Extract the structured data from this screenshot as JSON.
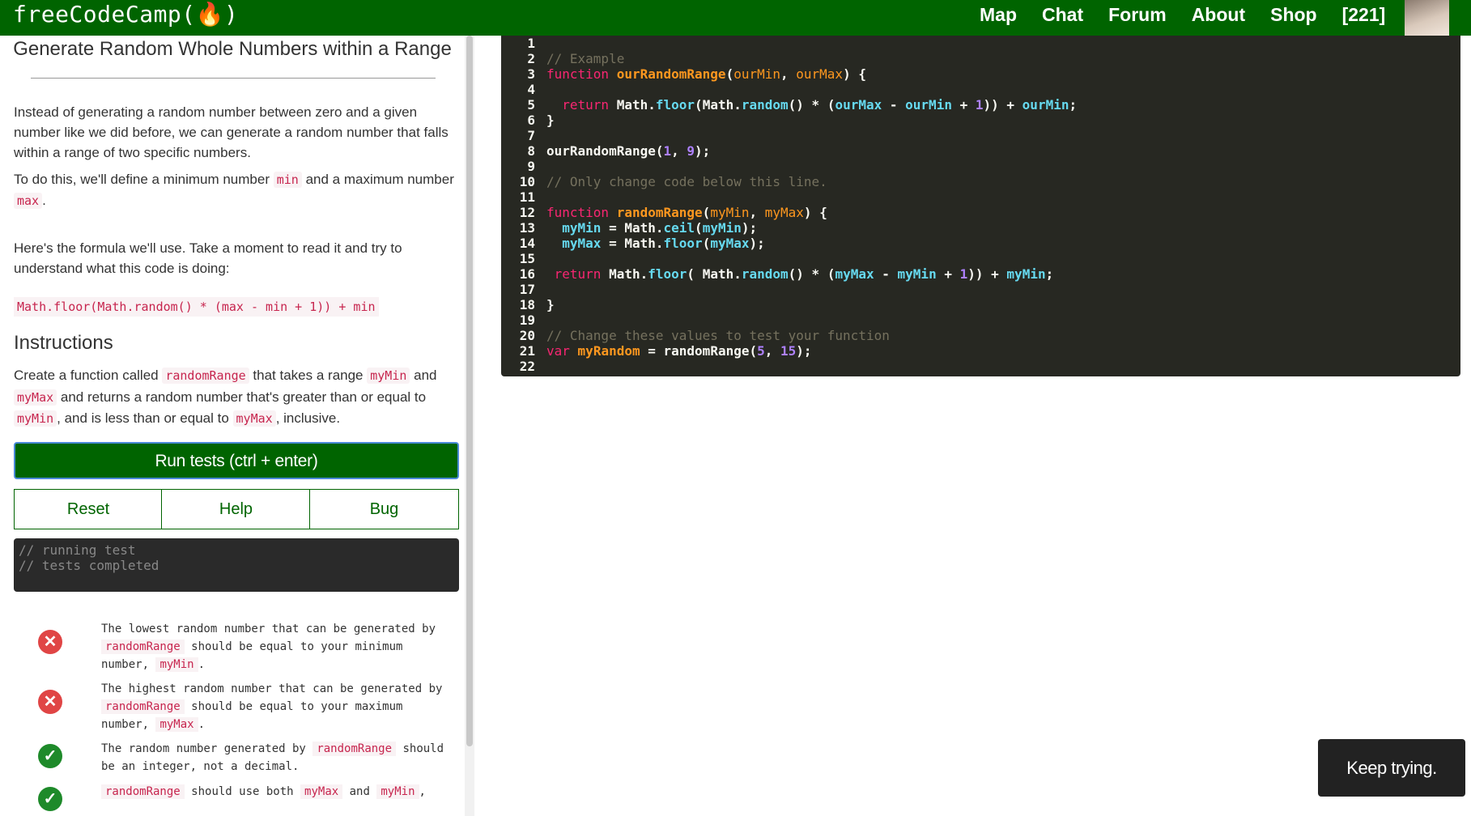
{
  "nav": {
    "brand": "freeCodeCamp(🔥)",
    "links": [
      "Map",
      "Chat",
      "Forum",
      "About",
      "Shop",
      "[221]"
    ]
  },
  "challenge": {
    "title": "Generate Random Whole Numbers within a Range",
    "para1": "Instead of generating a random number between zero and a given number like we did before, we can generate a random number that falls within a range of two specific numbers.",
    "para2_a": "To do this, we'll define a minimum number",
    "para2_min": "min",
    "para2_b": "and a maximum number",
    "para2_max": "max",
    "para2_c": ".",
    "para3": "Here's the formula we'll use. Take a moment to read it and try to understand what this code is doing:",
    "formula": "Math.floor(Math.random() * (max - min + 1)) + min",
    "instructions_heading": "Instructions",
    "instr_1": "Create a function called",
    "instr_randomRange": "randomRange",
    "instr_2": "that takes a range",
    "instr_myMin": "myMin",
    "instr_3": "and",
    "instr_myMax": "myMax",
    "instr_4": "and returns a random number that's greater than or equal to",
    "instr_myMin2": "myMin",
    "instr_5": ", and is less than or equal to",
    "instr_myMax2": "myMax",
    "instr_6": ", inclusive."
  },
  "buttons": {
    "run": "Run tests (ctrl + enter)",
    "reset": "Reset",
    "help": "Help",
    "bug": "Bug"
  },
  "console": {
    "line1": "// running test",
    "line2": "// tests completed"
  },
  "tests": [
    {
      "status": "fail",
      "a": "The lowest random number that can be generated by",
      "code1": "randomRange",
      "b": "should be equal to your minimum number,",
      "code2": "myMin",
      "c": "."
    },
    {
      "status": "fail",
      "a": "The highest random number that can be generated by",
      "code1": "randomRange",
      "b": "should be equal to your maximum number,",
      "code2": "myMax",
      "c": "."
    },
    {
      "status": "pass",
      "a": "The random number generated by",
      "code1": "randomRange",
      "b": "should be an integer, not a decimal."
    },
    {
      "status": "pass",
      "code1": "randomRange",
      "b": "should use both",
      "code2": "myMax",
      "c": "and",
      "code3": "myMin",
      "d": ","
    }
  ],
  "editor": {
    "line_numbers": [
      "1",
      "2",
      "3",
      "4",
      "5",
      "6",
      "7",
      "8",
      "9",
      "10",
      "11",
      "12",
      "13",
      "14",
      "15",
      "16",
      "17",
      "18",
      "19",
      "20",
      "21",
      "22"
    ],
    "code": {
      "l2": "// Example",
      "l3_kw": "function",
      "l3_fn": "ourRandomRange",
      "l3_p1": "ourMin",
      "l3_p2": "ourMax",
      "l5_ret": "return",
      "l5_math": "Math",
      "l5_floor": "floor",
      "l5_random": "random",
      "l5_max": "ourMax",
      "l5_min": "ourMin",
      "l5_one": "1",
      "l5_min2": "ourMin",
      "l8_call": "ourRandomRange",
      "l8_a": "1",
      "l8_b": "9",
      "l10": "// Only change code below this line.",
      "l12_kw": "function",
      "l12_fn": "randomRange",
      "l12_p1": "myMin",
      "l12_p2": "myMax",
      "l13_var": "myMin",
      "l13_math": "Math",
      "l13_ceil": "ceil",
      "l13_arg": "myMin",
      "l14_var": "myMax",
      "l14_math": "Math",
      "l14_floor": "floor",
      "l14_arg": "myMax",
      "l16_ret": "return",
      "l16_math": "Math",
      "l16_floor": "floor",
      "l16_math2": "Math",
      "l16_random": "random",
      "l16_max": "myMax",
      "l16_min": "myMin",
      "l16_one": "1",
      "l16_min2": "myMin",
      "l20": "// Change these values to test your function",
      "l21_kw": "var",
      "l21_var": "myRandom",
      "l21_call": "randomRange",
      "l21_a": "5",
      "l21_b": "15"
    }
  },
  "toast": "Keep trying."
}
